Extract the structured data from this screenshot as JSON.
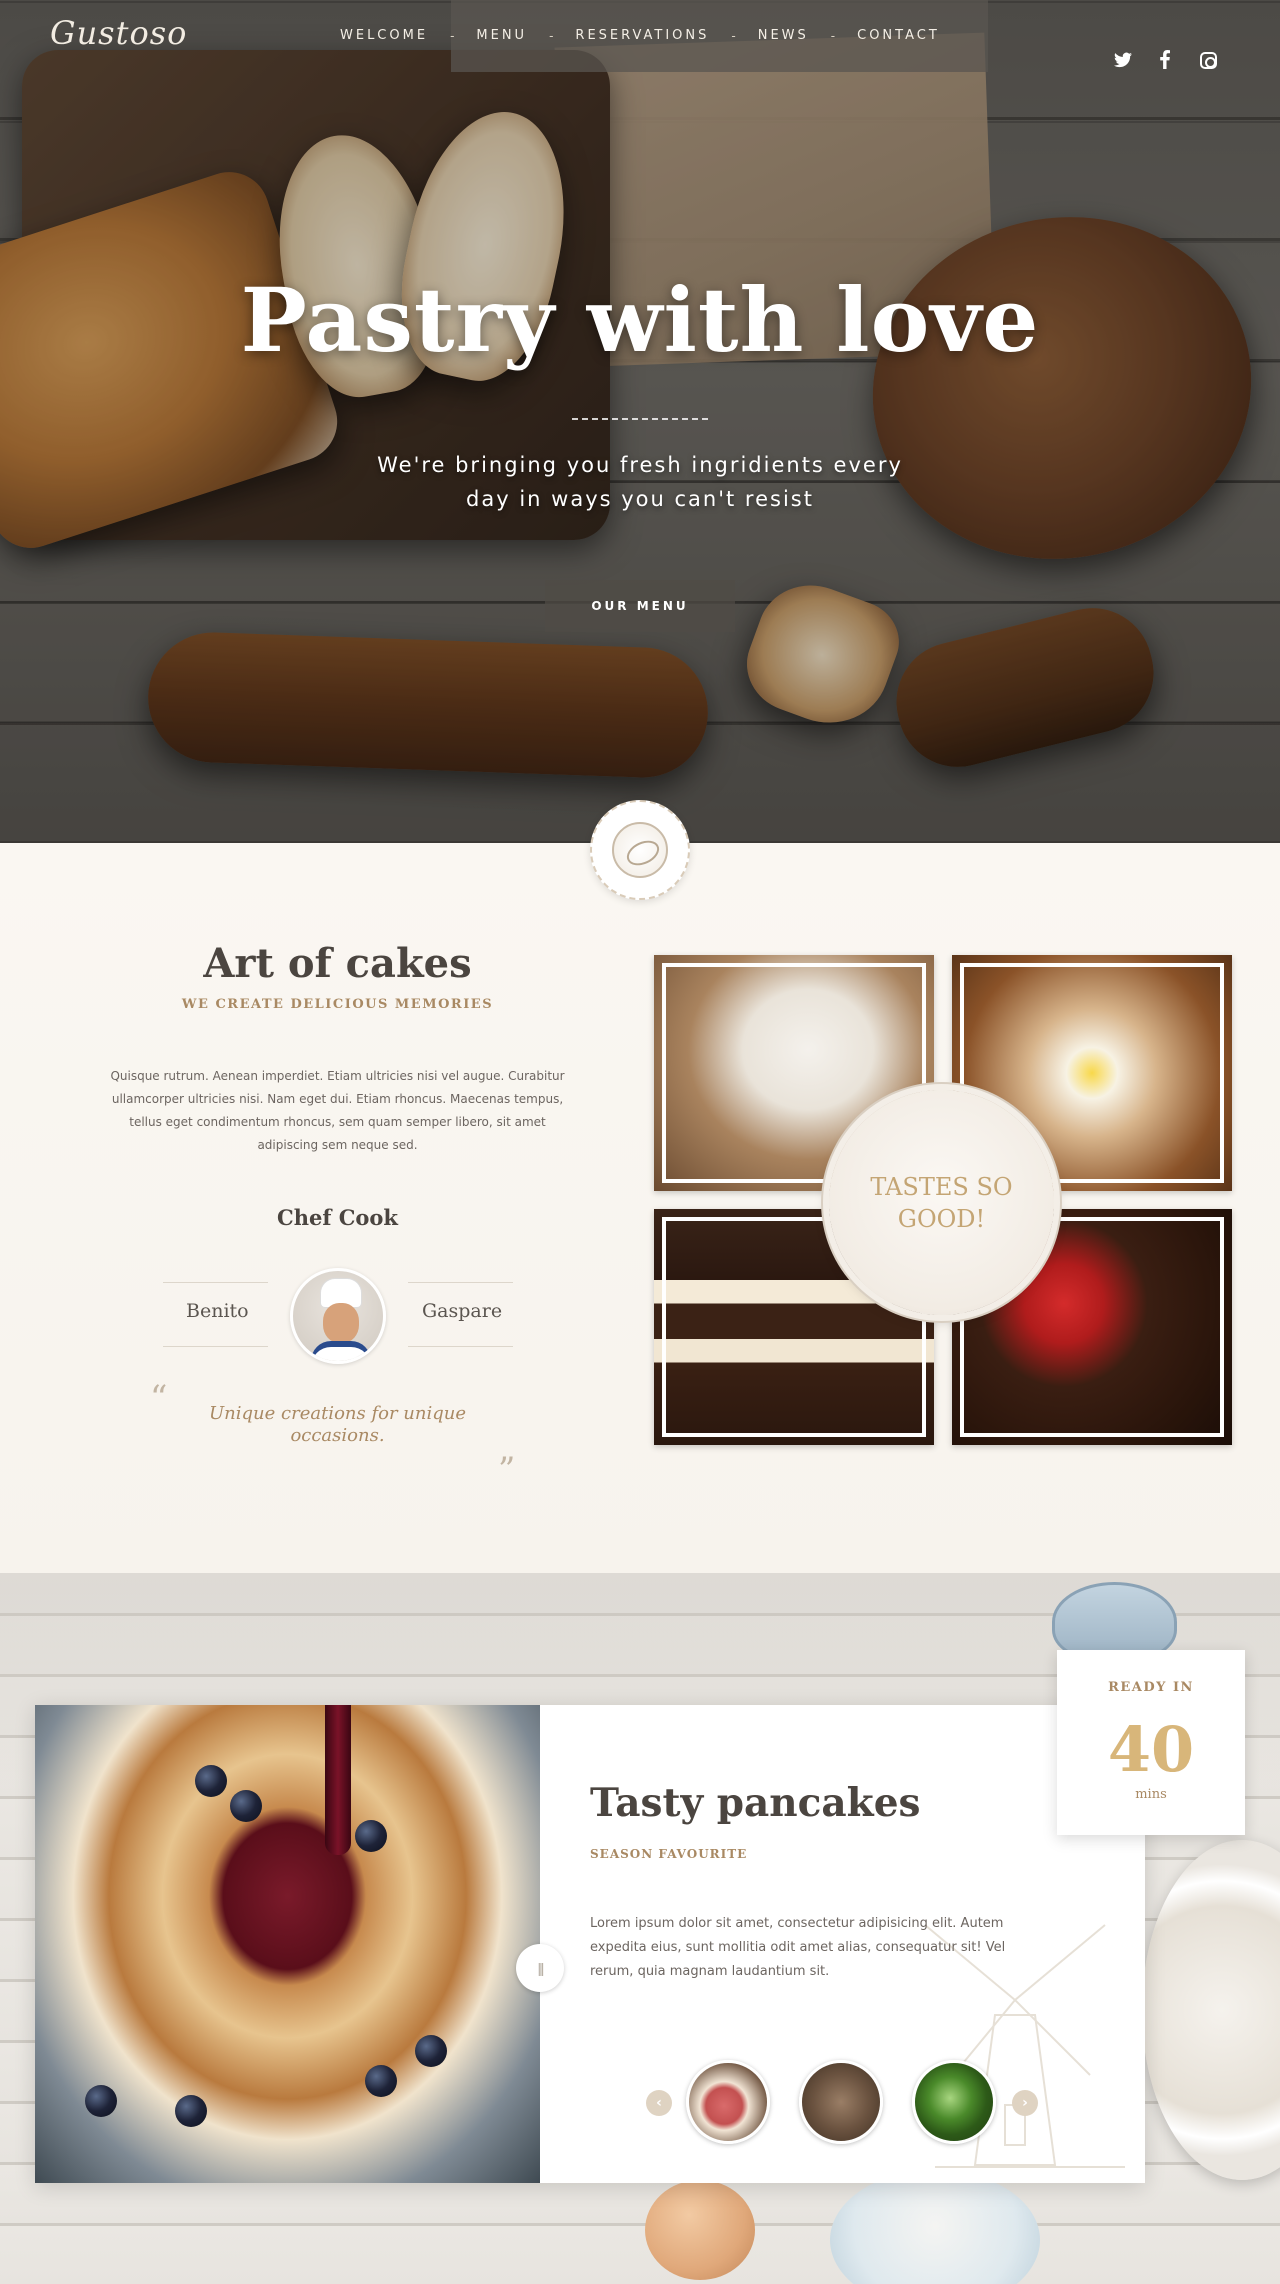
{
  "nav": {
    "logo": "Gustoso",
    "items": [
      "WELCOME",
      "MENU",
      "RESERVATIONS",
      "NEWS",
      "CONTACT"
    ],
    "separator": "-",
    "social": [
      "twitter-icon",
      "facebook-icon",
      "instagram-icon"
    ]
  },
  "hero": {
    "title": "Pastry with love",
    "subtitle_line1": "We're bringing you fresh ingridients every",
    "subtitle_line2": "day in ways you can't resist",
    "button": "OUR MENU"
  },
  "art": {
    "title": "Art of cakes",
    "subtitle": "WE CREATE DELICIOUS MEMORIES",
    "body": "Quisque rutrum. Aenean imperdiet. Etiam ultricies nisi vel augue. Curabitur ullamcorper ultricies nisi. Nam eget dui. Etiam rhoncus. Maecenas tempus, tellus eget condimentum rhoncus, sem quam semper libero, sit amet adipiscing sem neque sed.",
    "chef_title": "Chef Cook",
    "chef_first": "Benito",
    "chef_last": "Gaspare",
    "quote_open": "“",
    "quote_close": "”",
    "quote": "Unique creations for unique occasions.",
    "badge": "TASTES SO GOOD!"
  },
  "pancakes": {
    "title": "Tasty pancakes",
    "subtitle": "SEASON FAVOURITE",
    "body": "Lorem ipsum dolor sit amet, consectetur adipisicing elit. Autem expedita eius, sunt mollitia odit amet alias, consequatur sit! Vel rerum, quia magnam laudantium sit.",
    "slider_glyph": "|||",
    "prev": "‹",
    "next": "›",
    "ready_label": "READY IN",
    "ready_value": "40",
    "ready_unit": "mins"
  },
  "colors": {
    "accent": "#a98963",
    "gold": "#d8b67a",
    "heading": "#4b4540"
  }
}
